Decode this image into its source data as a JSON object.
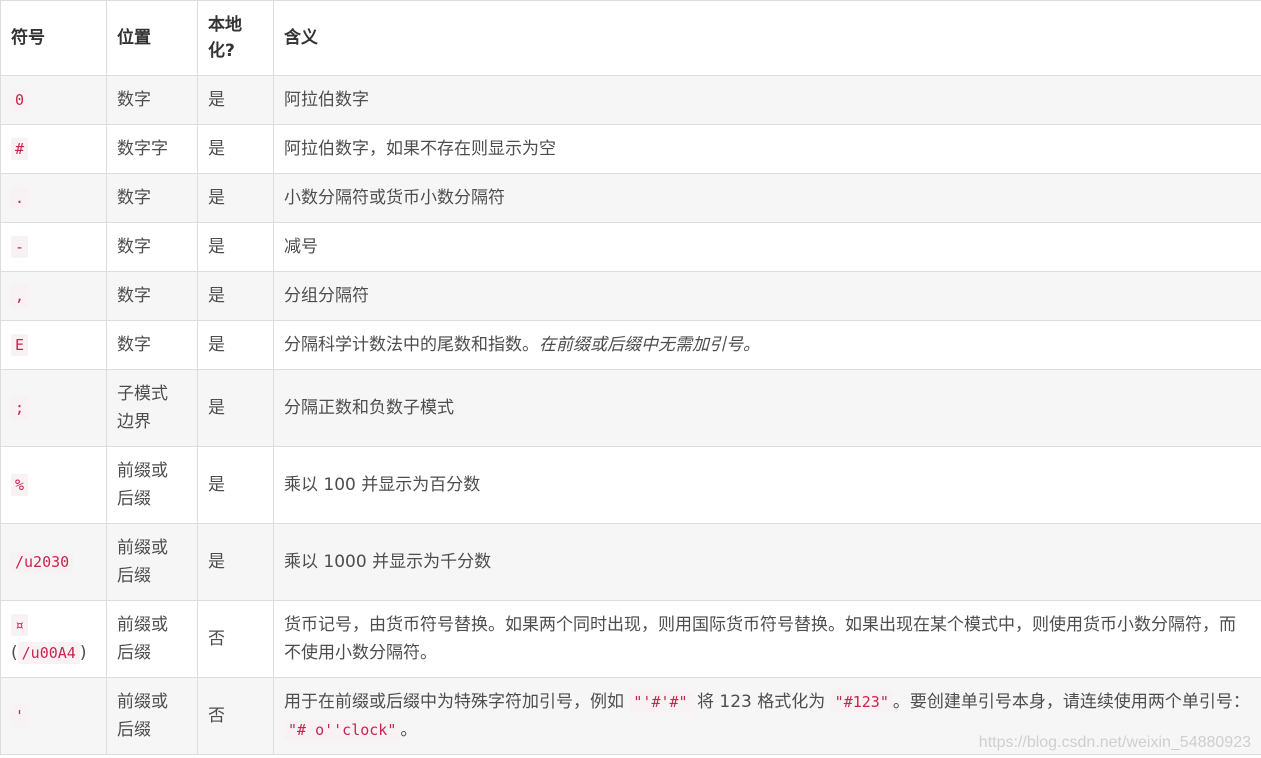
{
  "headers": {
    "symbol": "符号",
    "location": "位置",
    "localized_line1": "本地",
    "localized_line2": "化?",
    "meaning": "含义"
  },
  "rows": [
    {
      "symbol": "0",
      "location": "数字",
      "localized": "是",
      "meaning": "阿拉伯数字"
    },
    {
      "symbol": "#",
      "location": "数字字",
      "localized": "是",
      "meaning": "阿拉伯数字，如果不存在则显示为空"
    },
    {
      "symbol": ".",
      "location": "数字",
      "localized": "是",
      "meaning": "小数分隔符或货币小数分隔符"
    },
    {
      "symbol": "-",
      "location": "数字",
      "localized": "是",
      "meaning": "减号"
    },
    {
      "symbol": ",",
      "location": "数字",
      "localized": "是",
      "meaning": "分组分隔符"
    },
    {
      "symbol": "E",
      "location": "数字",
      "localized": "是",
      "meaning": "分隔科学计数法中的尾数和指数。",
      "meaning_italic": "在前缀或后缀中无需加引号。"
    },
    {
      "symbol": ";",
      "location_line1": "子模式",
      "location_line2": "边界",
      "localized": "是",
      "meaning": "分隔正数和负数子模式"
    },
    {
      "symbol": "%",
      "location_line1": "前缀或",
      "location_line2": "后缀",
      "localized": "是",
      "meaning": "乘以 100 并显示为百分数"
    },
    {
      "symbol": "/u2030",
      "location_line1": "前缀或",
      "location_line2": "后缀",
      "localized": "是",
      "meaning": "乘以 1000 并显示为千分数"
    },
    {
      "symbol": "¤",
      "symbol_paren_open": "(",
      "symbol_code": "/u00A4",
      "symbol_paren_close": ")",
      "location_line1": "前缀或",
      "location_line2": "后缀",
      "localized": "否",
      "meaning": "货币记号，由货币符号替换。如果两个同时出现，则用国际货币符号替换。如果出现在某个模式中，则使用货币小数分隔符，而不使用小数分隔符。"
    },
    {
      "symbol": "'",
      "location_line1": "前缀或",
      "location_line2": "后缀",
      "localized": "否",
      "meaning_part1": "用于在前缀或后缀中为特殊字符加引号，例如 ",
      "meaning_code1": "\"'#'#\"",
      "meaning_part2": " 将 123 格式化为 ",
      "meaning_code2": "\"#123\"",
      "meaning_part3": "。要创建单引号本身，请连续使用两个单引号： ",
      "meaning_code3": "\"# o''clock\"",
      "meaning_part4": "。"
    }
  ],
  "watermark": "https://blog.csdn.net/weixin_54880923"
}
